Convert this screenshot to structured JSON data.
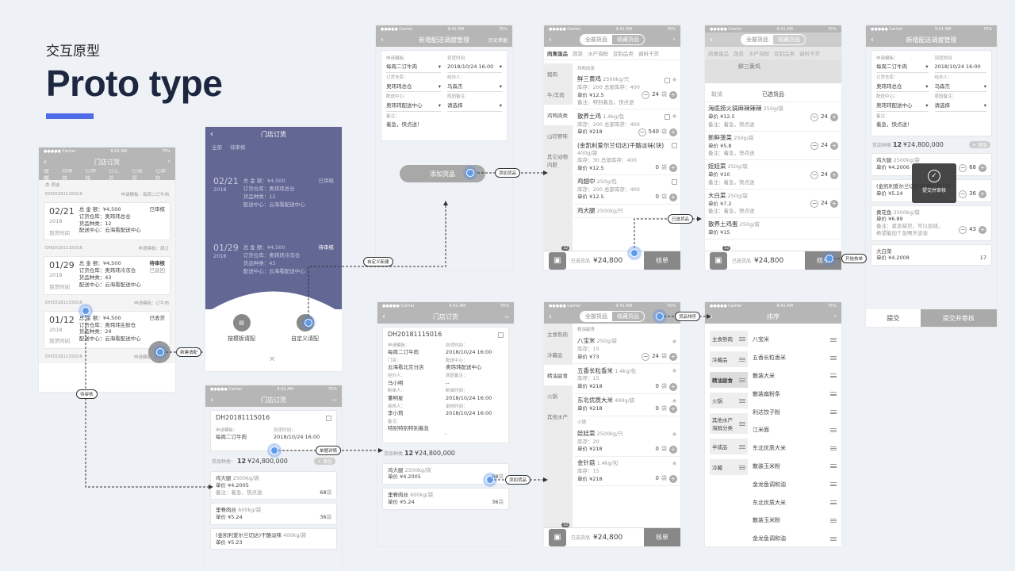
{
  "header": {
    "subtitle": "交互原型",
    "title": "Proto type"
  },
  "status": {
    "carrier": "●●●●● Carrier",
    "time": "9:41 AM",
    "battery": "75%"
  },
  "s1": {
    "title": "门店订货",
    "tabs": [
      "全部",
      "待审核",
      "已审核",
      "已汇总",
      "已收货",
      "已库存"
    ],
    "filter": "类 筛选",
    "orders": [
      {
        "id": "DH20181115016",
        "tpl": "申请模板：每周二订牛肉",
        "date": "02/21",
        "year": "2018",
        "amount": "总 金 额：¥4,500",
        "wh": "订货仓库：奥玮玮总仓",
        "kinds": "货品种类：12",
        "center": "配送中心：云海看配送中心",
        "status": "已审核",
        "foot": "到货时间"
      },
      {
        "id": "DH20181115016",
        "tpl": "申请模板：周订",
        "date": "01/29",
        "year": "2018",
        "amount": "总 金 额：¥4,500",
        "wh": "订货仓库：奥玮玮冷冻仓",
        "kinds": "货品种类：43",
        "center": "配送中心：云海看配送中心",
        "status": "待审核",
        "status2": "已退回",
        "foot": "到货时间"
      },
      {
        "id": "DH20181115016",
        "tpl": "申请模板：订牛肉",
        "date": "01/12",
        "year": "2018",
        "amount": "总 金 额：¥4,500",
        "wh": "订货仓库：奥玮玮生鲜仓",
        "kinds": "货品种类：24",
        "center": "配送中心：云海看配送中心",
        "status": "已收货",
        "foot": "到货时间"
      },
      {
        "id": "DH20181115016",
        "tpl": "申请模板：订水果"
      }
    ]
  },
  "s2": {
    "title": "门店订货",
    "tabs": [
      "全部",
      "待审核"
    ],
    "rows": [
      {
        "date": "02/21",
        "year": "2018",
        "a": "总 金 额：¥4,500",
        "b": "订货仓库：奥玮玮总仓",
        "c": "货品种类：12",
        "d": "配送中心：云海看配送中心",
        "st": "已审核"
      },
      {
        "date": "01/29",
        "year": "2018",
        "a": "总 金 额：¥4,500",
        "b": "订货仓库：奥玮玮冷冻仓",
        "c": "货品种类：43",
        "d": "配送中心：云海看配送中心",
        "st": "待审核"
      }
    ],
    "opt1": "按模板请配",
    "opt2": "自定义请配",
    "close": "✕"
  },
  "s3": {
    "title": "新增配送调拔管理",
    "right": "历史单据",
    "f1l": "申请模板：",
    "f1v": "每周二订牛肉",
    "f2l": "到货时间",
    "f2v": "2018/10/24 16:00",
    "f3l": "订货仓库：",
    "f3v": "奥玮玮总仓",
    "f4l": "经办人：",
    "f4v": "马森杰",
    "f5l": "配送中心：",
    "f5v": "奥玮玮配送中心",
    "f6l": "原因备注：",
    "f6v": "请选择",
    "f7l": "备注：",
    "f7v": "着急，快点送！",
    "add": "添加货品"
  },
  "s4": {
    "seg": [
      "全部货品",
      "收藏货品"
    ],
    "cats": [
      "肉禽蛋品",
      "蔬菜",
      "水产海鲜",
      "豆制品类",
      "调料干货"
    ],
    "side": [
      "猪肉",
      "牛/羊肉",
      "鸡鸭肉类",
      "山珍野味",
      "其它动物内脏"
    ],
    "sub": "鸡鸭肉类",
    "items": [
      {
        "n": "鲜三黄鸡",
        "u": "2500kg/只",
        "s": "库存：200  总部库存：400",
        "p": "单价 ¥12.5",
        "q": "24",
        "unit": "袋"
      },
      {
        "n": "散养土鸡",
        "u": "1.4kg/包",
        "s": "库存：200  总部库存：400",
        "p": "单价 ¥218",
        "q": "540",
        "unit": "袋"
      },
      {
        "n": "(金凯利爱尔兰切达)干酪淡味(块)",
        "u": "400g/袋",
        "s": "库存：30  总部库存：400",
        "p": "单价 ¥12.5",
        "q": "0",
        "unit": "袋"
      },
      {
        "n": "鸡翅中",
        "u": "250g/包",
        "s": "库存：200  总部库存：400",
        "p": "单价 ¥12.5",
        "q": "0",
        "unit": "袋"
      },
      {
        "n": "鸡大腿",
        "u": "2500kg/只",
        "s": "",
        "p": "",
        "q": "",
        "unit": ""
      }
    ],
    "badge": "32",
    "selected": "已选货品",
    "total": "¥24,800",
    "btn": "核单",
    "note1": "备注：特别着急，快点送"
  },
  "s5": {
    "cancel": "取消",
    "title": "已选货品",
    "items": [
      {
        "n": "海底捞火锅麻辣辣辣",
        "u": "250g/袋",
        "p": "单价 ¥12.5",
        "note": "备注：着急，快点送",
        "q": "24"
      },
      {
        "n": "新鲜菠菜",
        "u": "250g/袋",
        "p": "单价 ¥5.8",
        "note": "备注：着急，快点送",
        "q": "24"
      },
      {
        "n": "娃娃菜",
        "u": "250g/袋",
        "p": "单价 ¥10",
        "note": "备注：着急，快点送",
        "q": "24"
      },
      {
        "n": "大白菜",
        "u": "250g/袋",
        "p": "单价 ¥7.2",
        "note": "备注：着急，快点送",
        "q": "24"
      },
      {
        "n": "散养土鸡蛋",
        "u": "250g/袋",
        "p": "单价 ¥15",
        "note": "",
        "q": ""
      }
    ],
    "top": "鲜三黄鸡",
    "total": "¥24,800",
    "selected": "已选货品",
    "btn": "核单",
    "badge": "32"
  },
  "s6": {
    "title": "新增配送调拔管理",
    "f1v": "每周二订牛肉",
    "f2v": "2018/10/24 16:00",
    "f3v": "奥玮玮总仓",
    "f4v": "马森杰",
    "f5v": "奥玮玮配送中心",
    "f6v": "请选择",
    "f7v": "着急，快点送！",
    "f1l": "申请模板：",
    "f2l": "到货时间",
    "f3l": "订货仓库：",
    "f4l": "经办人：",
    "f5l": "配送中心：",
    "f6l": "原因备注：",
    "f7l": "备注：",
    "kinds": "货品种类",
    "kindsNum": "12",
    "total": "¥24,800,000",
    "add": "+ 添加",
    "toast": "提交并审核",
    "items": [
      {
        "n": "鸡大腿",
        "u": "2500kg/袋",
        "p": "单价 ¥4.2006",
        "q": "68",
        "unit": "袋"
      },
      {
        "n": "(金凯利爱尔兰切达)干酪淡味(块)",
        "u": "250g/袋",
        "p": "单价 ¥5.24",
        "q": "36",
        "unit": "袋"
      },
      {
        "n": "黄花鱼",
        "u": "2500kg/袋",
        "p": "单价 ¥6.89",
        "note": "备注：紧急缺货，可以加钱，希望能加个急啊天谈谈",
        "q": "43",
        "unit": "袋"
      },
      {
        "n": "大白菜",
        "u": "2500kg/袋",
        "p": "单价 ¥4.2008",
        "q": "17",
        "unit": "袋"
      }
    ],
    "b1": "提交",
    "b2": "提交并审核"
  },
  "s7": {
    "title": "门店订货",
    "id": "DH20181115016",
    "l1": "申请模板：",
    "v1": "每周二订牛肉",
    "l2": "到货时间：",
    "v2": "2018/10/24 16:00",
    "kinds": "货品种类：",
    "kindsNum": "12",
    "total": "¥24,800,000",
    "add": "+ 添加",
    "items": [
      {
        "n": "鸡大腿",
        "u": "2500kg/袋",
        "p": "单价 ¥4.2005",
        "note": "备注：着急，快点送",
        "q": "68",
        "unit": "袋"
      },
      {
        "n": "里脊肉丝",
        "u": "600kg/袋",
        "p": "单价 ¥5.24",
        "q": "36",
        "unit": "袋"
      },
      {
        "n": "(金凯利爱尔兰切达)干酪淡味",
        "u": "400kg/袋",
        "p": "单价 ¥5.23",
        "q": "",
        "unit": ""
      }
    ]
  },
  "s8": {
    "title": "门店订货",
    "id": "DH20181115016",
    "f": [
      [
        "申请模板：",
        "每周二订牛肉",
        "到货时间：",
        "2018/10/24 16:00"
      ],
      [
        "门店：",
        "云海看北京分店",
        "配送中心：",
        "奥玮玮配送中心"
      ],
      [
        "经办人：",
        "马小明",
        "原因备注：",
        "--"
      ],
      [
        "制单人：",
        "董明星",
        "制单时间：",
        "2018/10/24 16:00"
      ],
      [
        "审核人：",
        "李小莉",
        "审核时间：",
        "2018/10/24 16:00"
      ]
    ],
    "notel": "备注：",
    "notev": "特别特别特别着急",
    "kinds": "货品种类",
    "kindsNum": "12",
    "total": "¥24,800,000",
    "items": [
      {
        "n": "鸡大腿",
        "u": "2500kg/袋",
        "p": "单价 ¥4.2005",
        "q": "68",
        "unit": "袋"
      },
      {
        "n": "里脊肉丝",
        "u": "600kg/袋",
        "p": "单价 ¥5.24",
        "q": "36",
        "unit": "袋"
      }
    ]
  },
  "s9": {
    "seg": [
      "全部货品",
      "收藏货品"
    ],
    "side": [
      "主食熟肉",
      "冷藏品",
      "精油副食",
      "火锅",
      "其他水产"
    ],
    "sec1": "精油副食",
    "sec2": "火锅",
    "items": [
      {
        "n": "八宝米",
        "u": "250g/袋",
        "s": "库存：15",
        "p": "单价 ¥73",
        "q": "24",
        "unit": "袋"
      },
      {
        "n": "五香长粒香米",
        "u": "1.4kg/包",
        "s": "库存：15",
        "p": "单价 ¥218",
        "q": "0",
        "unit": "袋"
      },
      {
        "n": "东北优质大米",
        "u": "400g/袋",
        "s": "",
        "p": "单价 ¥218",
        "q": "0",
        "unit": "袋"
      },
      {
        "n": "娃娃菜",
        "u": "2500kg/只",
        "s": "库存：20",
        "p": "单价 ¥218",
        "q": "0",
        "unit": "袋"
      },
      {
        "n": "金针菇",
        "u": "1.4kg/包",
        "s": "库存：15",
        "p": "单价 ¥218",
        "q": "0",
        "unit": "袋"
      }
    ],
    "badge": "32",
    "selected": "已选货品",
    "total": "¥24,800",
    "btn": "核单"
  },
  "s10": {
    "title": "排序",
    "left": [
      "主食熟肉",
      "冷藏品",
      "精油副食",
      "火锅",
      "其他水产海鲜分类",
      "半成品",
      "冷藏"
    ],
    "right": [
      "八宝米",
      "五香长粒香米",
      "散装大米",
      "散装扁粉条",
      "利达饺子粉",
      "江米面",
      "东北优质大米",
      "散装玉米粉",
      "金龙鱼调和油",
      "东北优质大米",
      "散装玉米粉",
      "金龙鱼调和油"
    ]
  },
  "tags": {
    "t1": "新建请配",
    "t2": "待审核",
    "t3": "自定义新建",
    "t4": "添加货品",
    "t5": "已选货品",
    "t6": "开始核单",
    "t7": "单据详情",
    "t8": "添加货品",
    "t9": "货品排序"
  },
  "colors": {
    "accent": "#4f6be8",
    "gray": "#b6b6b6",
    "dot": "#5b9bea",
    "overlay": "#5b5f8e"
  }
}
